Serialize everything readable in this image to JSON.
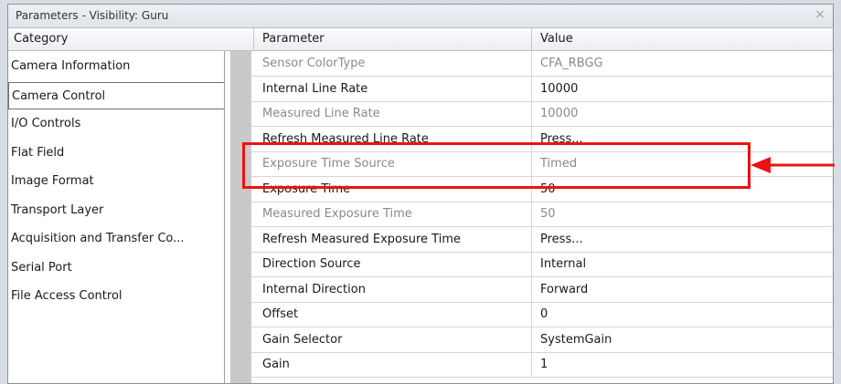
{
  "window": {
    "title": "Parameters - Visibility: Guru",
    "close_icon": "close-icon"
  },
  "columns": {
    "category": "Category",
    "parameter": "Parameter",
    "value": "Value"
  },
  "categories": [
    {
      "label": "Camera Information",
      "selected": false
    },
    {
      "label": "Camera Control",
      "selected": true
    },
    {
      "label": "I/O Controls",
      "selected": false
    },
    {
      "label": "Flat Field",
      "selected": false
    },
    {
      "label": "Image Format",
      "selected": false
    },
    {
      "label": "Transport Layer",
      "selected": false
    },
    {
      "label": "Acquisition and Transfer Co...",
      "selected": false
    },
    {
      "label": "Serial Port",
      "selected": false
    },
    {
      "label": "File Access Control",
      "selected": false
    }
  ],
  "parameters": [
    {
      "name": "Sensor ColorType",
      "value": "CFA_RBGG",
      "readonly": true
    },
    {
      "name": "Internal Line Rate",
      "value": "10000",
      "readonly": false
    },
    {
      "name": "Measured Line Rate",
      "value": "10000",
      "readonly": true
    },
    {
      "name": "Refresh Measured Line Rate",
      "value": "Press...",
      "readonly": false
    },
    {
      "name": "Exposure Time Source",
      "value": "Timed",
      "readonly": true
    },
    {
      "name": "Exposure Time",
      "value": "50",
      "readonly": false
    },
    {
      "name": "Measured Exposure Time",
      "value": "50",
      "readonly": true
    },
    {
      "name": "Refresh Measured Exposure Time",
      "value": "Press...",
      "readonly": false
    },
    {
      "name": "Direction Source",
      "value": "Internal",
      "readonly": false
    },
    {
      "name": "Internal Direction",
      "value": "Forward",
      "readonly": false
    },
    {
      "name": "Offset",
      "value": "0",
      "readonly": false
    },
    {
      "name": "Gain Selector",
      "value": "SystemGain",
      "readonly": false
    },
    {
      "name": "Gain",
      "value": "1",
      "readonly": false
    }
  ],
  "annotation": {
    "color": "#ee1111",
    "highlight_icon": "highlight-box",
    "arrow_icon": "arrow-left-icon"
  }
}
